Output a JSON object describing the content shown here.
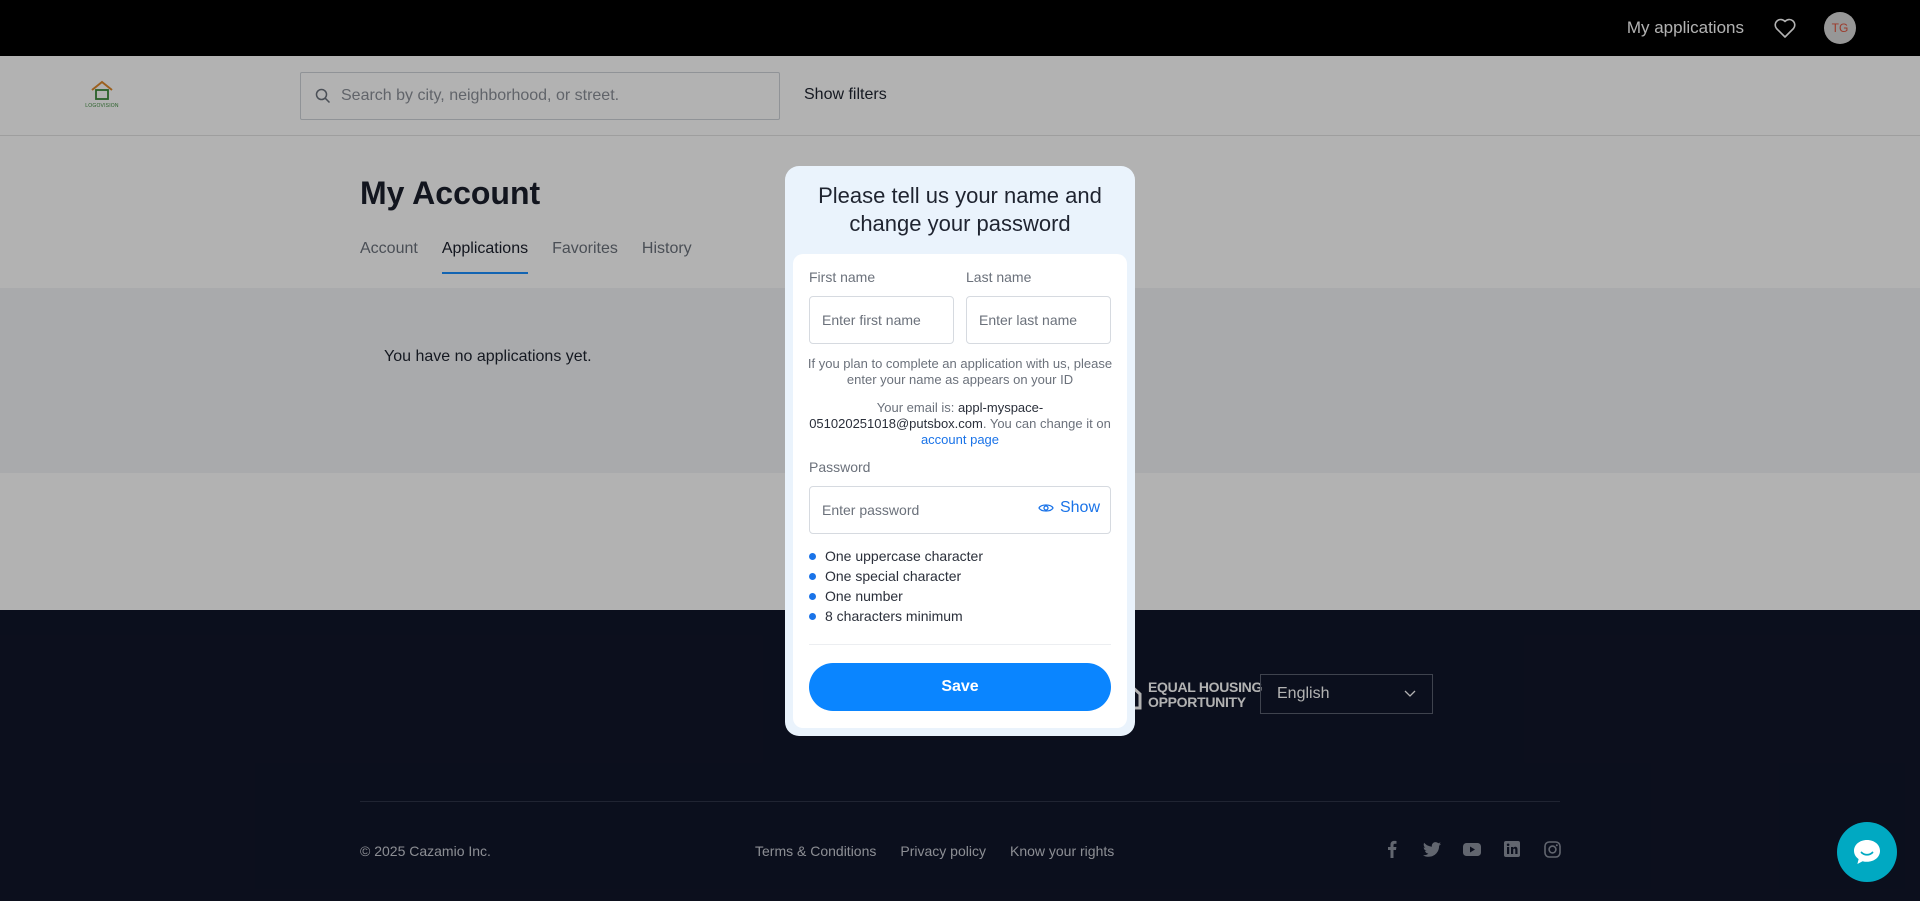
{
  "topbar": {
    "my_applications": "My applications",
    "avatar_initials": "TG"
  },
  "header": {
    "logo_text": "LOGOVISION",
    "search_placeholder": "Search by city, neighborhood, or street.",
    "show_filters": "Show filters"
  },
  "account": {
    "title": "My Account",
    "tabs": [
      {
        "label": "Account"
      },
      {
        "label": "Applications"
      },
      {
        "label": "Favorites"
      },
      {
        "label": "History"
      }
    ],
    "active_tab": "Applications",
    "empty_message": "You have no applications yet."
  },
  "modal": {
    "title": "Please tell us your name and change your password",
    "first_name_label": "First name",
    "first_name_placeholder": "Enter first name",
    "last_name_label": "Last name",
    "last_name_placeholder": "Enter last name",
    "id_note": "If you plan to complete an application with us, please enter your name as appears on your ID",
    "email_prefix": "Your email is: ",
    "email": "appl-myspace-051020251018@putsbox.com",
    "email_suffix": ". You can change it on ",
    "account_page_link": "account page",
    "password_label": "Password",
    "password_placeholder": "Enter password",
    "show_label": "Show",
    "rules": [
      "One uppercase character",
      "One special character",
      "One number",
      "8 characters minimum"
    ],
    "save_label": "Save"
  },
  "footer": {
    "eho_line1": "EQUAL HOUSING",
    "eho_line2": "OPPORTUNITY",
    "language": "English",
    "copyright": "© 2025 Cazamio Inc.",
    "links": [
      "Terms & Conditions",
      "Privacy policy",
      "Know your rights"
    ],
    "socials": [
      "facebook-icon",
      "twitter-icon",
      "youtube-icon",
      "linkedin-icon",
      "instagram-icon"
    ]
  },
  "colors": {
    "accent": "#0a85ff",
    "link": "#1a73e8",
    "footer_bg": "#11162a",
    "chat": "#00a9c2"
  }
}
